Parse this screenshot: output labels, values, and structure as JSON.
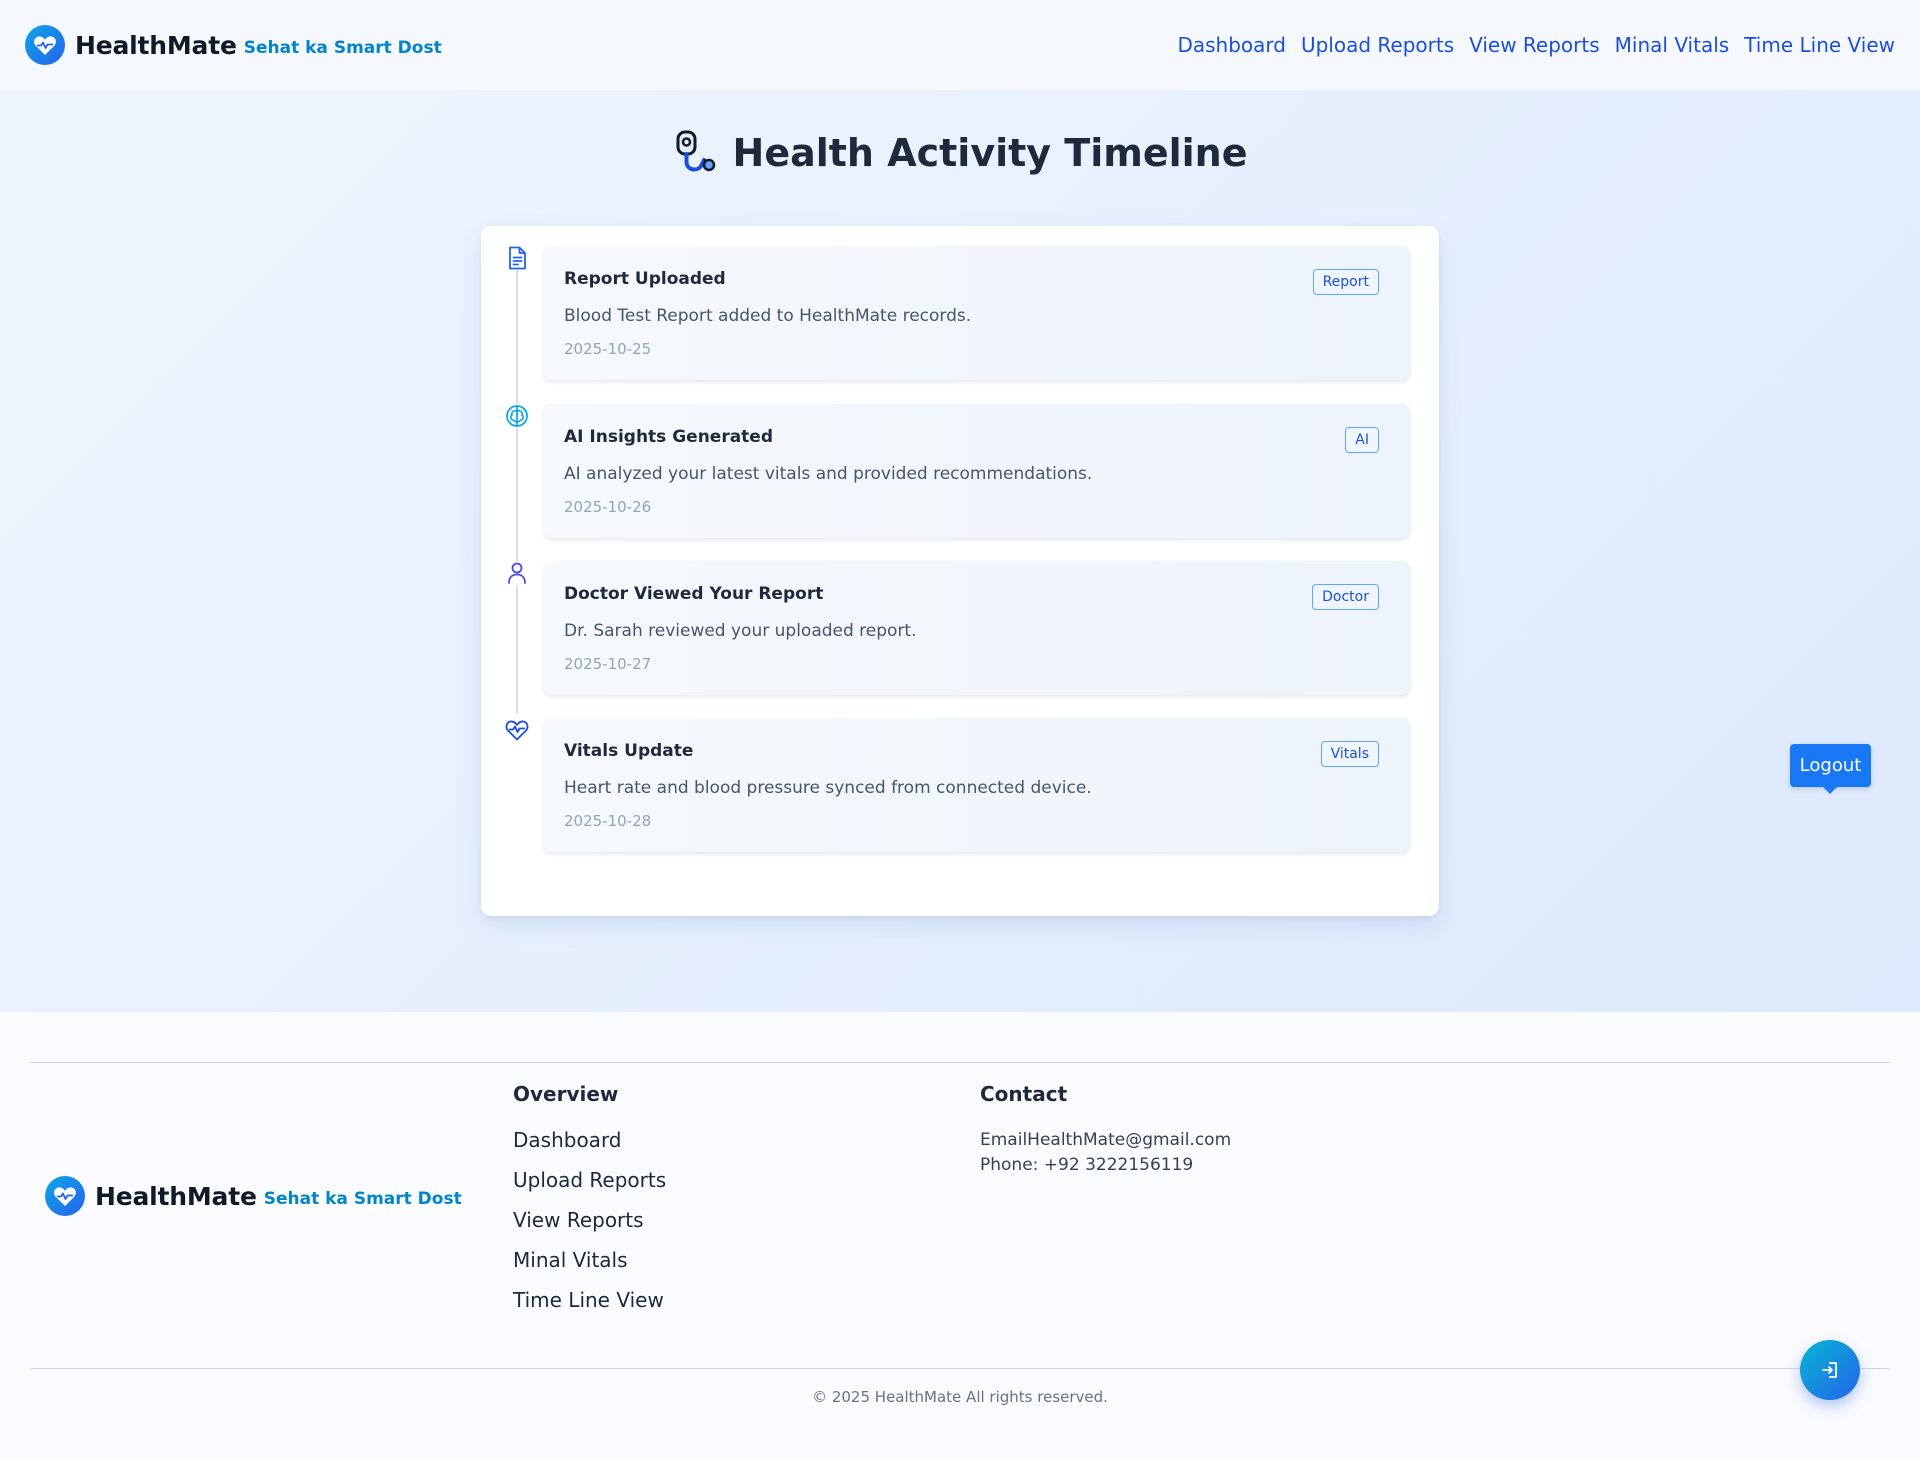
{
  "brand": {
    "name": "HealthMate",
    "tagline": "Sehat ka Smart Dost"
  },
  "nav": {
    "items": [
      "Dashboard",
      "Upload Reports",
      "View Reports",
      "Minal Vitals",
      "Time Line View"
    ]
  },
  "page": {
    "title": "Health Activity Timeline"
  },
  "timeline": [
    {
      "icon": "document-icon",
      "title": "Report Uploaded",
      "badge": "Report",
      "description": "Blood Test Report added to HealthMate records.",
      "date": "2025-10-25"
    },
    {
      "icon": "brain-icon",
      "title": "AI Insights Generated",
      "badge": "AI",
      "description": "AI analyzed your latest vitals and provided recommendations.",
      "date": "2025-10-26"
    },
    {
      "icon": "user-icon",
      "title": "Doctor Viewed Your Report",
      "badge": "Doctor",
      "description": "Dr. Sarah reviewed your uploaded report.",
      "date": "2025-10-27"
    },
    {
      "icon": "heart-pulse-icon",
      "title": "Vitals Update",
      "badge": "Vitals",
      "description": "Heart rate and blood pressure synced from connected device.",
      "date": "2025-10-28"
    }
  ],
  "logout_tooltip": "Logout",
  "footer": {
    "overview_heading": "Overview",
    "overview_links": [
      "Dashboard",
      "Upload Reports",
      "View Reports",
      "Minal Vitals",
      "Time Line View"
    ],
    "contact_heading": "Contact",
    "contact_email": "EmailHealthMate@gmail.com",
    "contact_phone": "Phone: +92 3222156119",
    "copyright": "© 2025 HealthMate All rights reserved."
  },
  "colors": {
    "accent": "#1877f2",
    "brand_gradient_start": "#0ea5e9",
    "brand_gradient_end": "#2563eb",
    "nav_link": "#1d4ed8"
  }
}
